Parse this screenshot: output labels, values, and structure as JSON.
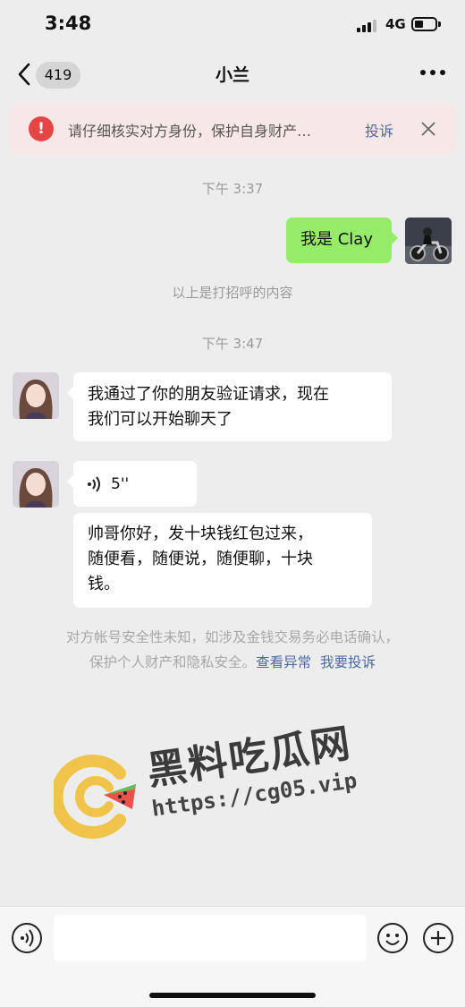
{
  "status": {
    "time": "3:48",
    "network": "4G"
  },
  "nav": {
    "unread_count": "419",
    "title": "小兰"
  },
  "warning": {
    "text": "请仔细核实对方身份，保护自身财产…",
    "complain_label": "投诉"
  },
  "messages": {
    "time1": "下午 3:37",
    "outgoing_text": "我是 Clay",
    "greeting_note": "以上是打招呼的内容",
    "time2": "下午 3:47",
    "incoming_line1": "我通过了你的朋友验证请求，现在",
    "incoming_line2": "我们可以开始聊天了",
    "voice_duration": "5''",
    "incoming2_line1": "帅哥你好，发十块钱红包过来，",
    "incoming2_line2": "随便看，随便说，随便聊，十块",
    "incoming2_line3": "钱。"
  },
  "notice": {
    "line1": "对方帐号安全性未知，如涉及金钱交易务必电话确认，",
    "line2_prefix": "保护个人财产和隐私安全。",
    "link_view": "查看异常",
    "link_complain": "我要投诉"
  },
  "watermark": {
    "title": "黑料吃瓜网",
    "url": "https://cg05.vip"
  },
  "colors": {
    "bubble_green": "#95ec69",
    "link_blue": "#4b6aa3",
    "warning_red": "#e64545"
  }
}
